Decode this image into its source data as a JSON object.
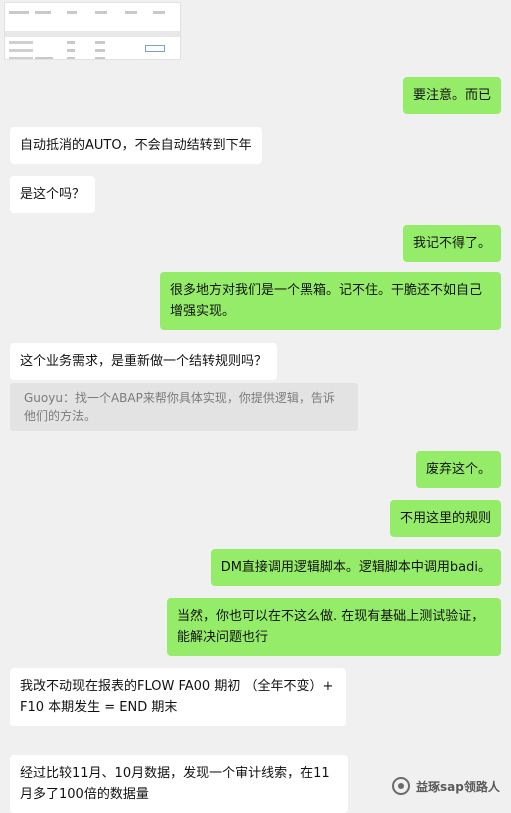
{
  "messages": [
    {
      "side": "right",
      "text": "要注意。而已"
    },
    {
      "side": "left",
      "text": "自动抵消的AUTO，不会自动结转到下年"
    },
    {
      "side": "left",
      "text": "是这个吗？"
    },
    {
      "side": "right",
      "text": "我记不得了。"
    },
    {
      "side": "right",
      "text": "很多地方对我们是一个黑箱。记不住。干脆还不如自己增强实现。"
    },
    {
      "side": "left",
      "text": "这个业务需求，是重新做一个结转规则吗？"
    },
    {
      "side": "quote",
      "text": "Guoyu：找一个ABAP来帮你具体实现，你提供逻辑，告诉他们的方法。"
    },
    {
      "side": "right",
      "text": "废弃这个。"
    },
    {
      "side": "right",
      "text": "不用这里的规则"
    },
    {
      "side": "right",
      "text": "DM直接调用逻辑脚本。逻辑脚本中调用badi。"
    },
    {
      "side": "right",
      "text": "当然，你也可以在不这么做. 在现有基础上测试验证，能解决问题也行"
    },
    {
      "side": "left",
      "text": "我改不动现在报表的FLOW FA00 期初 （全年不变）+ F10 本期发生 = END 期末"
    },
    {
      "side": "left",
      "text": "经过比较11月、10月数据，发现一个审计线索，在11月多了100倍的数据量"
    }
  ],
  "watermark": {
    "text": "益琢sap领路人",
    "icon": "wechat-official-account-icon"
  },
  "colors": {
    "background": "#f0f0f0",
    "self_bubble": "#95ec69",
    "other_bubble": "#ffffff",
    "quote": "#e3e3e3"
  }
}
